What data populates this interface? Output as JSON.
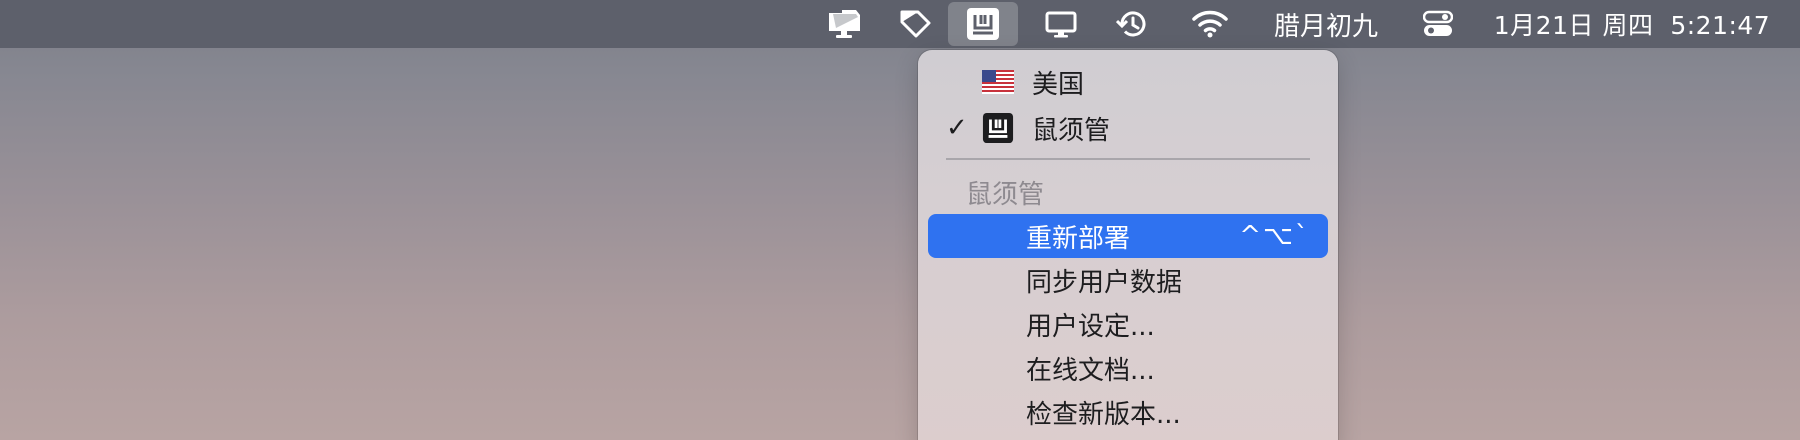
{
  "menubar": {
    "icons": [
      {
        "name": "clipboard-tray-icon"
      },
      {
        "name": "tag-icon"
      },
      {
        "name": "input-method-icon",
        "active": true
      },
      {
        "name": "display-icon"
      },
      {
        "name": "time-machine-icon"
      },
      {
        "name": "wifi-icon"
      }
    ],
    "lunar_date": "腊月初九",
    "control_center_icon": "control-center-icon",
    "clock": "1月21日 周四  5:21:47"
  },
  "menu": {
    "input_sources": [
      {
        "label": "美国",
        "icon": "us-flag-icon",
        "checked": false
      },
      {
        "label": "鼠须管",
        "icon": "squirrel-ime-icon",
        "checked": true
      }
    ],
    "check_mark": "✓",
    "section_title": "鼠须管",
    "items": [
      {
        "label": "重新部署",
        "shortcut": "^⌥`",
        "highlighted": true
      },
      {
        "label": "同步用户数据"
      },
      {
        "label": "用户设定..."
      },
      {
        "label": "在线文档..."
      },
      {
        "label": "检查新版本..."
      }
    ]
  },
  "colors": {
    "menubar_bg": "#5d606b",
    "highlight": "#2f72f0"
  }
}
